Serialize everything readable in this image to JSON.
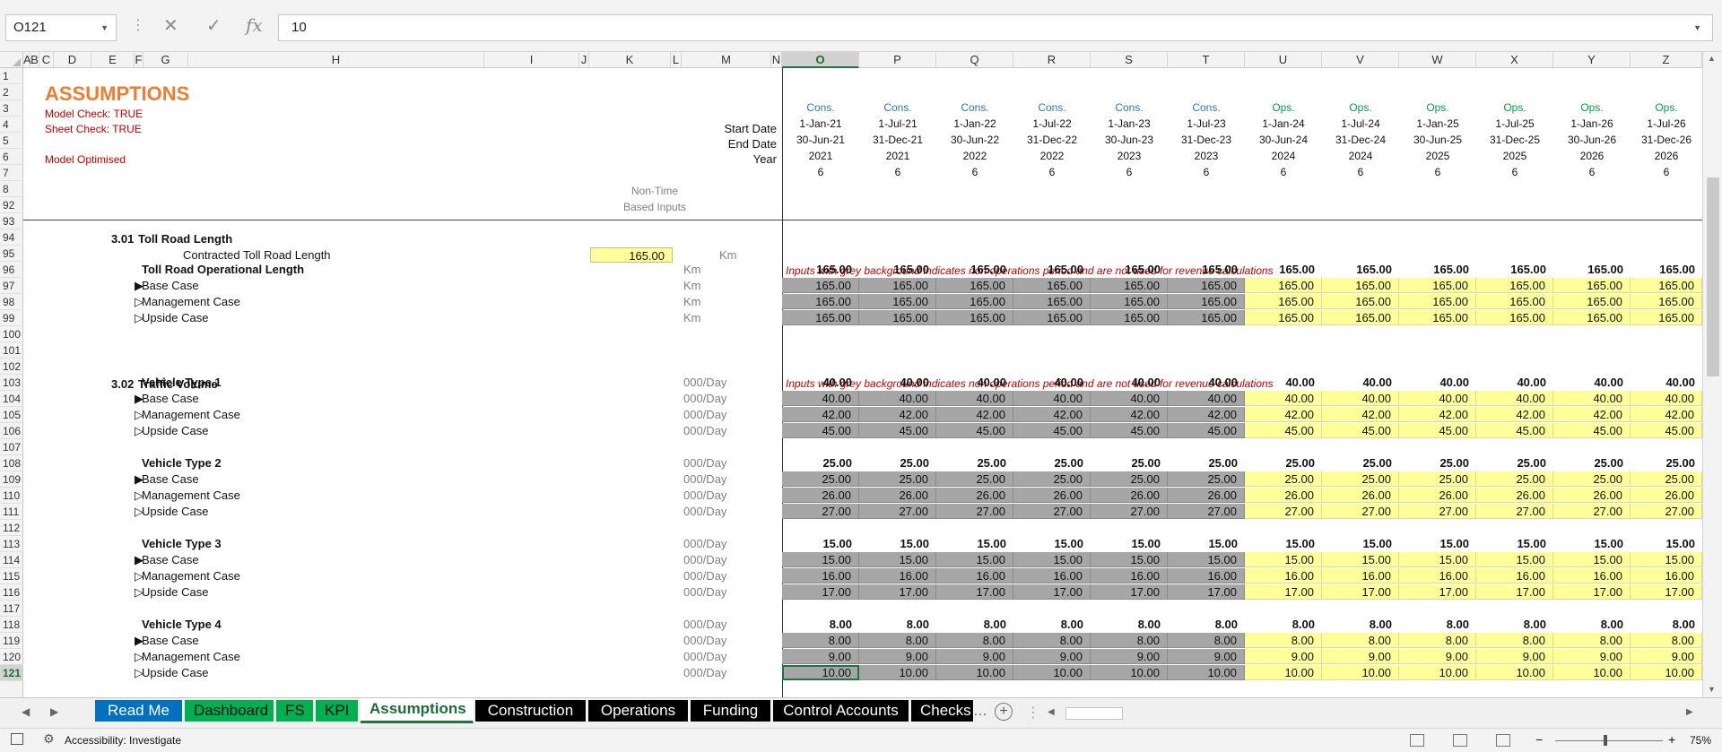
{
  "formula_bar": {
    "name_box": "O121",
    "formula": "10",
    "cancel_icon": "close-icon",
    "enter_icon": "check-icon",
    "function_icon": "fx-icon"
  },
  "columns": [
    "A",
    "B",
    "C",
    "D",
    "E",
    "F",
    "G",
    "H",
    "I",
    "J",
    "K",
    "L",
    "M",
    "N",
    "O",
    "P",
    "Q",
    "R",
    "S",
    "T",
    "U",
    "V",
    "W",
    "X",
    "Y",
    "Z"
  ],
  "selected_column": "O",
  "rows": [
    "1",
    "2",
    "3",
    "4",
    "5",
    "6",
    "7",
    "8",
    "92",
    "93",
    "94",
    "95",
    "96",
    "97",
    "98",
    "99",
    "100",
    "101",
    "102",
    "103",
    "104",
    "105",
    "106",
    "107",
    "108",
    "109",
    "110",
    "111",
    "112",
    "113",
    "114",
    "115",
    "116",
    "117",
    "118",
    "119",
    "120",
    "121"
  ],
  "selected_row": "121",
  "header": {
    "title": "ASSUMPTIONS",
    "model_check": "Model Check: TRUE",
    "sheet_check": "Sheet Check: TRUE",
    "model_optimised": "Model Optimised",
    "non_time_1": "Non-Time",
    "non_time_2": "Based Inputs",
    "start_date_label": "Start Date",
    "end_date_label": "End Date",
    "year_label": "Year"
  },
  "timeline": {
    "phase": [
      "Cons.",
      "Cons.",
      "Cons.",
      "Cons.",
      "Cons.",
      "Cons.",
      "Ops.",
      "Ops.",
      "Ops.",
      "Ops.",
      "Ops.",
      "Ops."
    ],
    "start": [
      "1-Jan-21",
      "1-Jul-21",
      "1-Jan-22",
      "1-Jul-22",
      "1-Jan-23",
      "1-Jul-23",
      "1-Jan-24",
      "1-Jul-24",
      "1-Jan-25",
      "1-Jul-25",
      "1-Jan-26",
      "1-Jul-26"
    ],
    "end": [
      "30-Jun-21",
      "31-Dec-21",
      "30-Jun-22",
      "31-Dec-22",
      "30-Jun-23",
      "31-Dec-23",
      "30-Jun-24",
      "31-Dec-24",
      "30-Jun-25",
      "31-Dec-25",
      "30-Jun-26",
      "31-Dec-26"
    ],
    "year": [
      "2021",
      "2021",
      "2022",
      "2022",
      "2023",
      "2023",
      "2024",
      "2024",
      "2025",
      "2025",
      "2026",
      "2026"
    ],
    "months": [
      "6",
      "6",
      "6",
      "6",
      "6",
      "6",
      "6",
      "6",
      "6",
      "6",
      "6",
      "6"
    ]
  },
  "section_301": {
    "number": "3.01",
    "title": "Toll Road Length",
    "contracted_label": "Contracted Toll Road Length",
    "contracted_value": "165.00",
    "unit": "Km",
    "note": "Inputs with grey background indicates non operations period and are not used for revenue calculations",
    "operational_label": "Toll Road Operational Length",
    "rows": [
      {
        "label": "Toll Road Operational Length",
        "unit": "Km",
        "values": [
          "165.00",
          "165.00",
          "165.00",
          "165.00",
          "165.00",
          "165.00",
          "165.00",
          "165.00",
          "165.00",
          "165.00",
          "165.00",
          "165.00"
        ]
      },
      {
        "label": "Base Case",
        "unit": "Km",
        "values": [
          "165.00",
          "165.00",
          "165.00",
          "165.00",
          "165.00",
          "165.00",
          "165.00",
          "165.00",
          "165.00",
          "165.00",
          "165.00",
          "165.00"
        ]
      },
      {
        "label": "Management Case",
        "unit": "Km",
        "values": [
          "165.00",
          "165.00",
          "165.00",
          "165.00",
          "165.00",
          "165.00",
          "165.00",
          "165.00",
          "165.00",
          "165.00",
          "165.00",
          "165.00"
        ]
      },
      {
        "label": "Upside Case",
        "unit": "Km",
        "values": [
          "165.00",
          "165.00",
          "165.00",
          "165.00",
          "165.00",
          "165.00",
          "165.00",
          "165.00",
          "165.00",
          "165.00",
          "165.00",
          "165.00"
        ]
      }
    ]
  },
  "section_302": {
    "number": "3.02",
    "title": "Traffic Volume",
    "note": "Inputs with grey background indicates non operations period and are not used for revenue calculations",
    "unit": "000/Day",
    "groups": [
      {
        "title": "Vehicle Type 1",
        "total": "40.00",
        "base": "40.00",
        "mgmt": "42.00",
        "upside": "45.00"
      },
      {
        "title": "Vehicle Type 2",
        "total": "25.00",
        "base": "25.00",
        "mgmt": "26.00",
        "upside": "27.00"
      },
      {
        "title": "Vehicle Type 3",
        "total": "15.00",
        "base": "15.00",
        "mgmt": "16.00",
        "upside": "17.00"
      },
      {
        "title": "Vehicle Type 4",
        "total": "8.00",
        "base": "8.00",
        "mgmt": "9.00",
        "upside": "10.00"
      }
    ],
    "case_labels": [
      "Base Case",
      "Management Case",
      "Upside Case"
    ]
  },
  "sheet_tabs": [
    {
      "label": "Read Me",
      "style": "blue"
    },
    {
      "label": "Dashboard",
      "style": "greenbg"
    },
    {
      "label": "FS",
      "style": "greenbg"
    },
    {
      "label": "KPI",
      "style": "greenbg"
    },
    {
      "label": "Assumptions",
      "style": "active"
    },
    {
      "label": "Construction",
      "style": "black"
    },
    {
      "label": "Operations",
      "style": "black"
    },
    {
      "label": "Funding",
      "style": "black"
    },
    {
      "label": "Control Accounts",
      "style": "black"
    },
    {
      "label": "Checks",
      "style": "black"
    }
  ],
  "status_bar": {
    "accessibility": "Accessibility: Investigate",
    "zoom": "75%",
    "zoom_level": 0.75
  }
}
